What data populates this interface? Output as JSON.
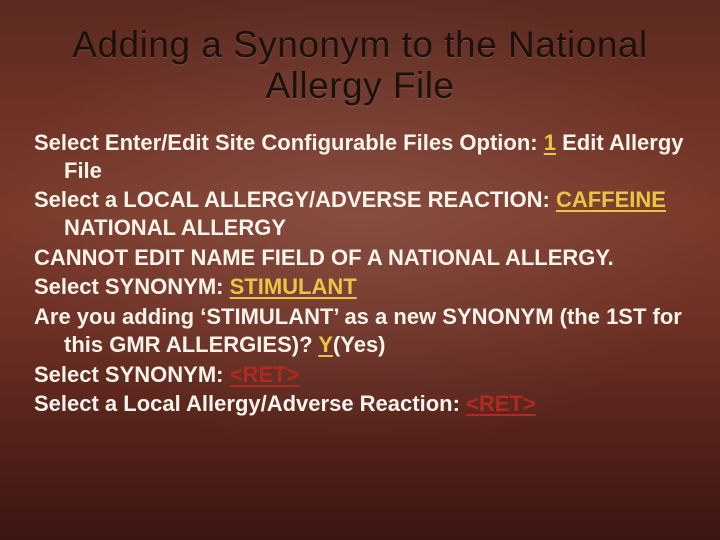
{
  "title": "Adding a Synonym to the National Allergy File",
  "lines": {
    "l1a": "Select Enter/Edit Site Configurable Files Option: ",
    "l1_input": "1",
    "l1b": " Edit Allergy File",
    "l2a": "Select a LOCAL ALLERGY/ADVERSE REACTION: ",
    "l2_input": "CAFFEINE",
    "l2_gap": "                   ",
    "l2b": "NATIONAL ALLERGY",
    "l3": "CANNOT EDIT NAME FIELD OF A NATIONAL ALLERGY.",
    "l4a": "Select SYNONYM: ",
    "l4_input": "STIMULANT",
    "l5a": "Are you adding ‘STIMULANT’ as a new SYNONYM (the 1ST for this GMR ALLERGIES)? ",
    "l5_input": "Y",
    "l5b": "(Yes)",
    "l6a": "Select SYNONYM: ",
    "l6_input": "<RET>",
    "l7a": "Select a Local Allergy/Adverse Reaction: ",
    "l7_input": "<RET>"
  }
}
